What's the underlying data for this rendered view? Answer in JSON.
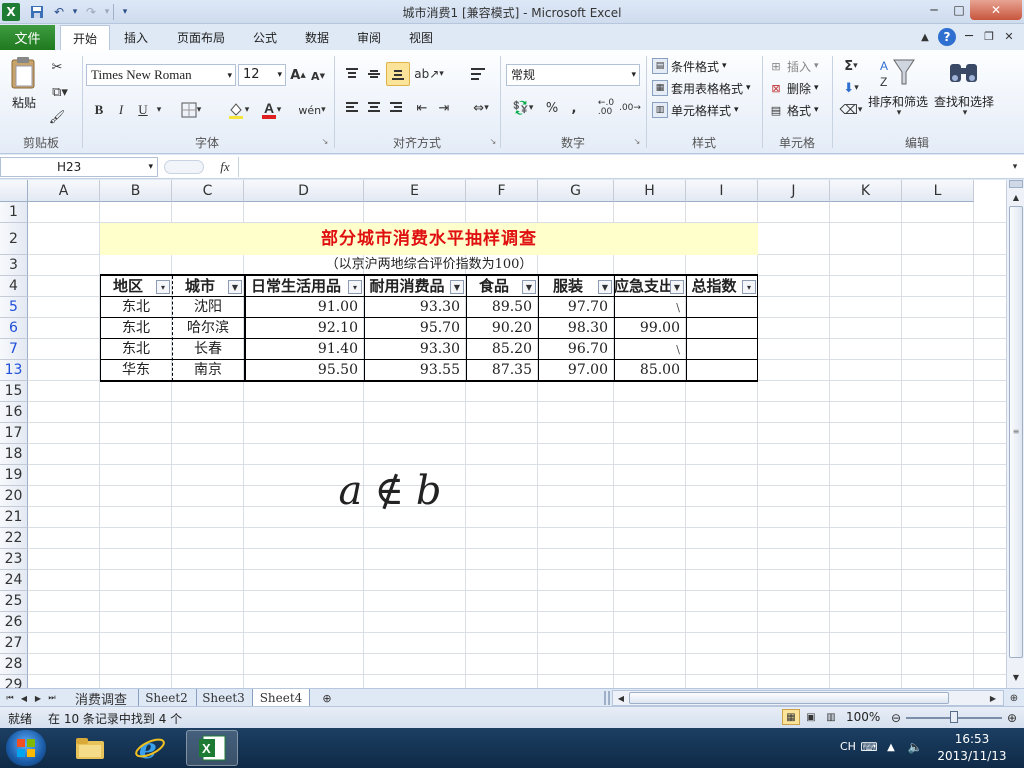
{
  "window": {
    "title": "城市消费1 [兼容模式] - Microsoft Excel"
  },
  "quick_access": {
    "excel_icon": "excel-logo-icon",
    "save_icon": "save-icon",
    "undo_icon": "undo-icon",
    "redo_icon": "redo-icon",
    "customize_icon": "chevron-down-icon"
  },
  "window_controls": {
    "minimize": "─",
    "maximize": "□",
    "close": "✕"
  },
  "menu": {
    "file": "文件",
    "tabs": [
      "开始",
      "插入",
      "页面布局",
      "公式",
      "数据",
      "审阅",
      "视图"
    ],
    "active_index": 0
  },
  "ribbon": {
    "groups": [
      "剪贴板",
      "字体",
      "对齐方式",
      "数字",
      "样式",
      "单元格",
      "编辑"
    ],
    "paste_label": "粘贴",
    "font_name": "Times New Roman",
    "font_size": "12",
    "number_format": "常规",
    "bold": "B",
    "italic": "I",
    "underline": "U",
    "styles": {
      "conditional": "条件格式",
      "table_format": "套用表格格式",
      "cell_style": "单元格样式"
    },
    "cells": {
      "insert": "插入",
      "delete": "删除",
      "format": "格式"
    },
    "editing": {
      "sigma": "Σ",
      "sort_filter": "排序和筛选",
      "find_select": "查找和选择"
    },
    "percent": "%",
    "comma": ","
  },
  "formula_bar": {
    "name_box": "H23",
    "fx": "fx",
    "formula": ""
  },
  "sheet": {
    "columns": [
      "A",
      "B",
      "C",
      "D",
      "E",
      "F",
      "G",
      "H",
      "I",
      "J",
      "K",
      "L"
    ],
    "rows": [
      "1",
      "2",
      "3",
      "4",
      "5",
      "6",
      "7",
      "13",
      "15",
      "16",
      "17",
      "18",
      "19",
      "20",
      "21",
      "22",
      "23",
      "24",
      "25",
      "26",
      "27",
      "28",
      "29"
    ],
    "title": "部分城市消费水平抽样调查",
    "subtitle": "（以京沪两地综合评价指数为100）",
    "headers": [
      "地区",
      "城市",
      "日常生活用品",
      "耐用消费品",
      "食品",
      "服装",
      "应急支出",
      "总指数"
    ],
    "data_rows": [
      {
        "region": "东北",
        "city": "沈阳",
        "daily": "91.00",
        "durable": "93.30",
        "food": "89.50",
        "clothing": "97.70",
        "emergency": "\\",
        "total": ""
      },
      {
        "region": "东北",
        "city": "哈尔滨",
        "daily": "92.10",
        "durable": "95.70",
        "food": "90.20",
        "clothing": "98.30",
        "emergency": "99.00",
        "total": ""
      },
      {
        "region": "东北",
        "city": "长春",
        "daily": "91.40",
        "durable": "93.30",
        "food": "85.20",
        "clothing": "96.70",
        "emergency": "\\",
        "total": ""
      },
      {
        "region": "华东",
        "city": "南京",
        "daily": "95.50",
        "durable": "93.55",
        "food": "87.35",
        "clothing": "97.00",
        "emergency": "85.00",
        "total": ""
      }
    ],
    "formula_object": {
      "a": "a",
      "op": "∉",
      "b": "b"
    }
  },
  "sheet_tabs": {
    "tabs": [
      "消费调查",
      "Sheet2",
      "Sheet3",
      "Sheet4"
    ],
    "active_index": 3
  },
  "status": {
    "ready": "就绪",
    "message": "在 10 条记录中找到 4 个",
    "zoom": "100%"
  },
  "taskbar": {
    "lang": "CH",
    "time": "16:53",
    "date": "2013/11/13"
  }
}
